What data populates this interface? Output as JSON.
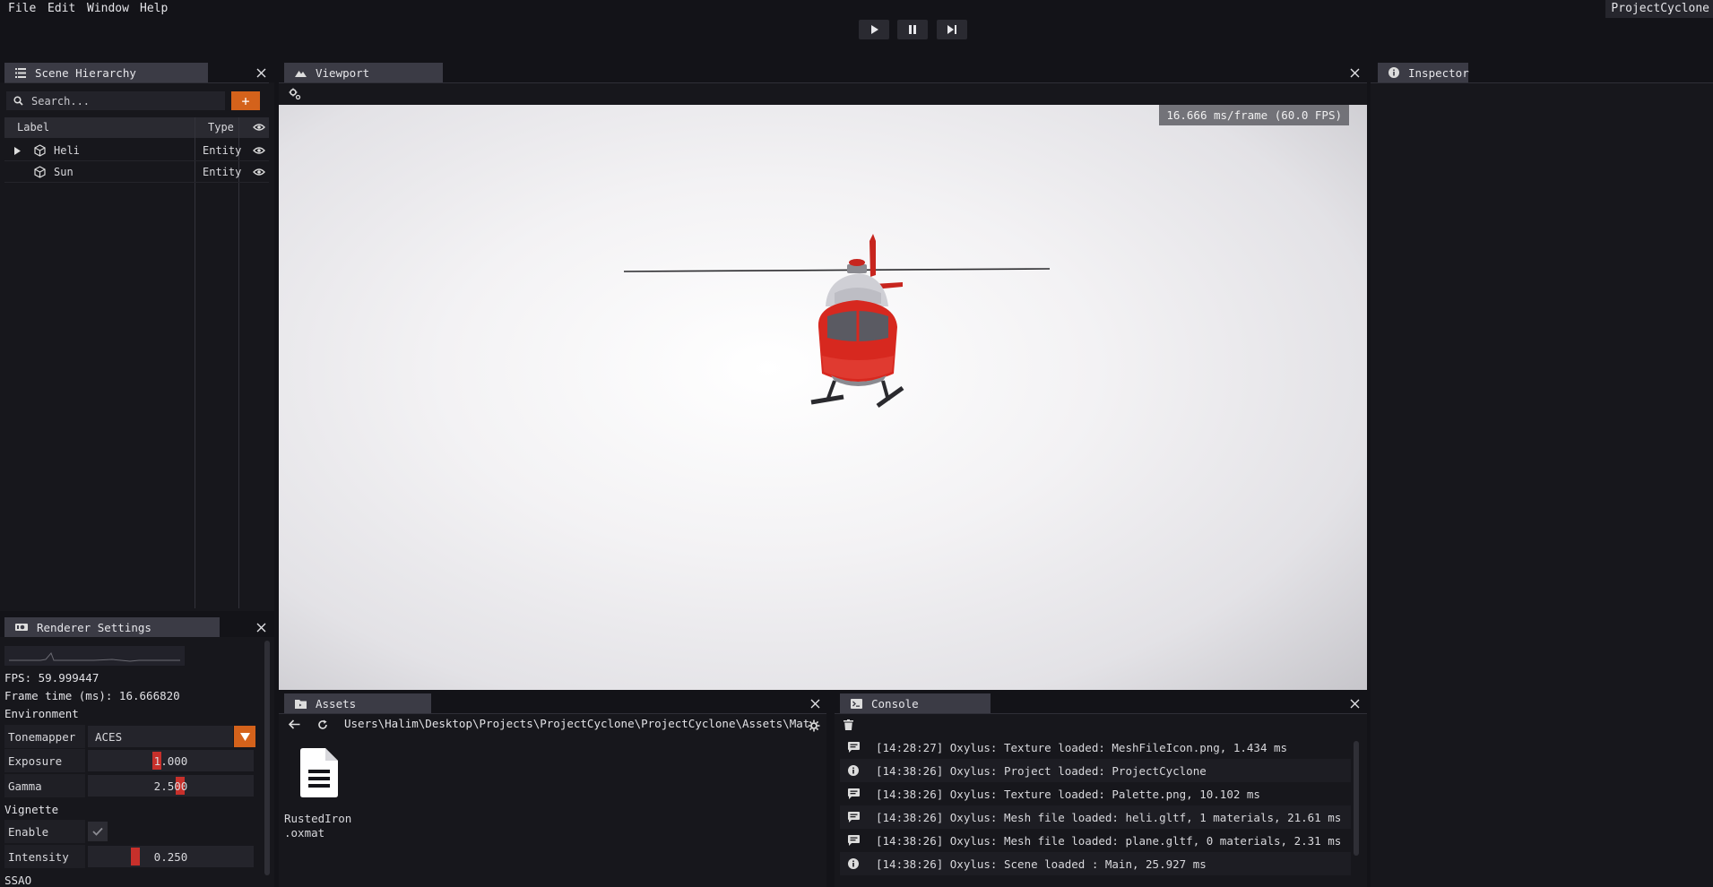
{
  "menu": {
    "file": "File",
    "edit": "Edit",
    "window": "Window",
    "help": "Help"
  },
  "project_name": "ProjectCyclone",
  "scene_hierarchy": {
    "title": "Scene Hierarchy",
    "search_placeholder": "Search...",
    "add_label": "+",
    "columns": {
      "label": "Label",
      "type": "Type"
    },
    "rows": [
      {
        "label": "Heli",
        "type": "Entity",
        "expandable": true
      },
      {
        "label": "Sun",
        "type": "Entity",
        "expandable": false
      }
    ]
  },
  "viewport": {
    "title": "Viewport",
    "fps_overlay": "16.666 ms/frame (60.0 FPS)"
  },
  "inspector": {
    "title": "Inspector"
  },
  "renderer": {
    "title": "Renderer Settings",
    "fps": "FPS: 59.999447",
    "frame_time": "Frame time (ms): 16.666820",
    "environment_header": "Environment",
    "tonemapper_label": "Tonemapper",
    "tonemapper_value": "ACES",
    "exposure_label": "Exposure",
    "exposure_value": "1.000",
    "exposure_level": 0.4,
    "gamma_label": "Gamma",
    "gamma_value": "2.500",
    "gamma_level": 0.56,
    "vignette_header": "Vignette",
    "enable_label": "Enable",
    "vignette_enabled": true,
    "intensity_label": "Intensity",
    "intensity_value": "0.250",
    "intensity_level": 0.25,
    "ssao_header": "SSAO"
  },
  "assets": {
    "title": "Assets",
    "path": "Users\\Halim\\Desktop\\Projects\\ProjectCyclone\\ProjectCyclone\\Assets\\Materials",
    "items": [
      {
        "name_line1": "RustedIron",
        "name_line2": ".oxmat"
      }
    ]
  },
  "console": {
    "title": "Console",
    "entries": [
      {
        "icon": "message-icon",
        "text": "[14:28:27] Oxylus: Texture loaded: MeshFileIcon.png, 1.434 ms"
      },
      {
        "icon": "info-icon",
        "text": "[14:38:26] Oxylus: Project loaded: ProjectCyclone"
      },
      {
        "icon": "message-icon",
        "text": "[14:38:26] Oxylus: Texture loaded: Palette.png, 10.102 ms"
      },
      {
        "icon": "message-icon",
        "text": "[14:38:26] Oxylus: Mesh file loaded: heli.gltf, 1 materials, 21.61 ms"
      },
      {
        "icon": "message-icon",
        "text": "[14:38:26] Oxylus: Mesh file loaded: plane.gltf, 0 materials, 2.31 ms"
      },
      {
        "icon": "info-icon",
        "text": "[14:38:26] Oxylus: Scene loaded : Main, 25.927 ms"
      }
    ]
  },
  "colors": {
    "accent": "#d4621b",
    "slider_grab": "#c7302b",
    "tab_bg": "#3b3b45",
    "panel_bg": "#17171c"
  }
}
